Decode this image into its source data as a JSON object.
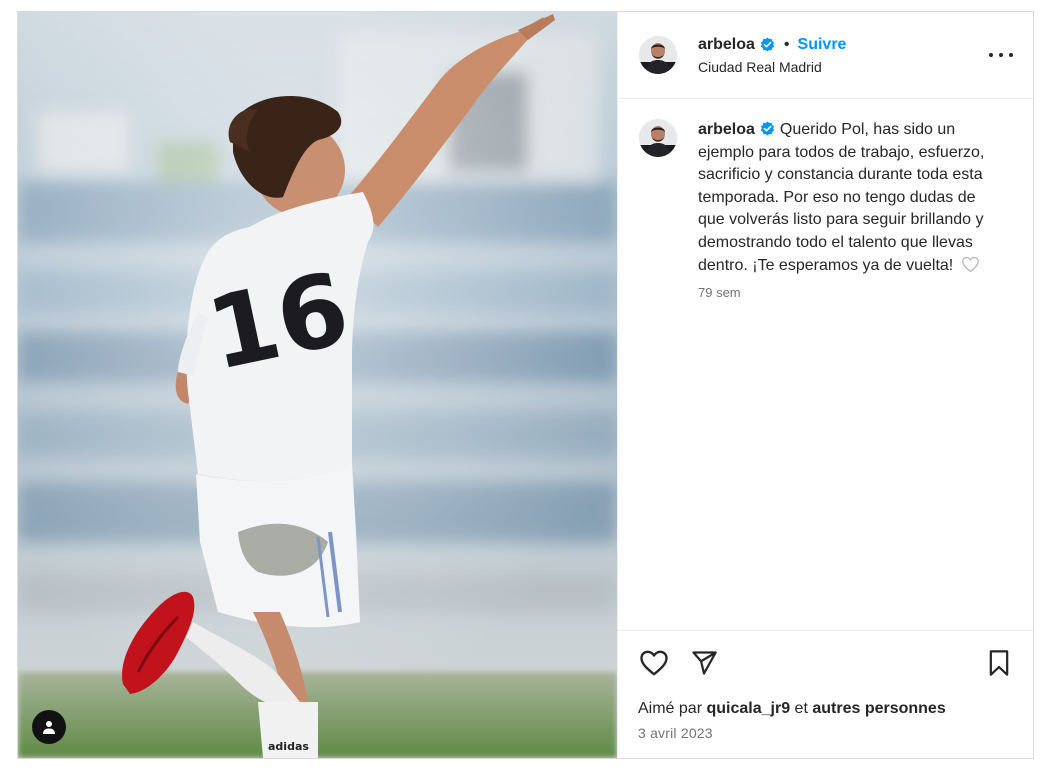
{
  "header": {
    "username": "arbeloa",
    "separator": "•",
    "follow_label": "Suivre",
    "location": "Ciudad Real Madrid"
  },
  "photo": {
    "jersey_number": "16",
    "boot_brand": "adidas"
  },
  "caption": {
    "username": "arbeloa",
    "text": "Querido Pol, has sido un ejemplo para todos de trabajo, esfuerzo, sacrificio y constancia durante toda esta temporada. Por eso no tengo dudas de que volverás listo para seguir brillando y demostrando todo el talento que llevas dentro. ¡Te esperamos ya de vuelta!",
    "time": "79 sem"
  },
  "likes": {
    "prefix": "Aimé par",
    "user": "quicala_jr9",
    "connector": "et",
    "others": "autres personnes"
  },
  "date": "3 avril 2023",
  "colors": {
    "accent": "#0095f6",
    "text": "#262626",
    "secondary": "#737373",
    "border": "#dbdbdb"
  },
  "icons": {
    "more": "more-options-icon",
    "like": "heart-icon",
    "share": "send-icon",
    "save": "bookmark-icon",
    "tag": "user-tag-icon",
    "verified": "verified-badge-icon"
  }
}
